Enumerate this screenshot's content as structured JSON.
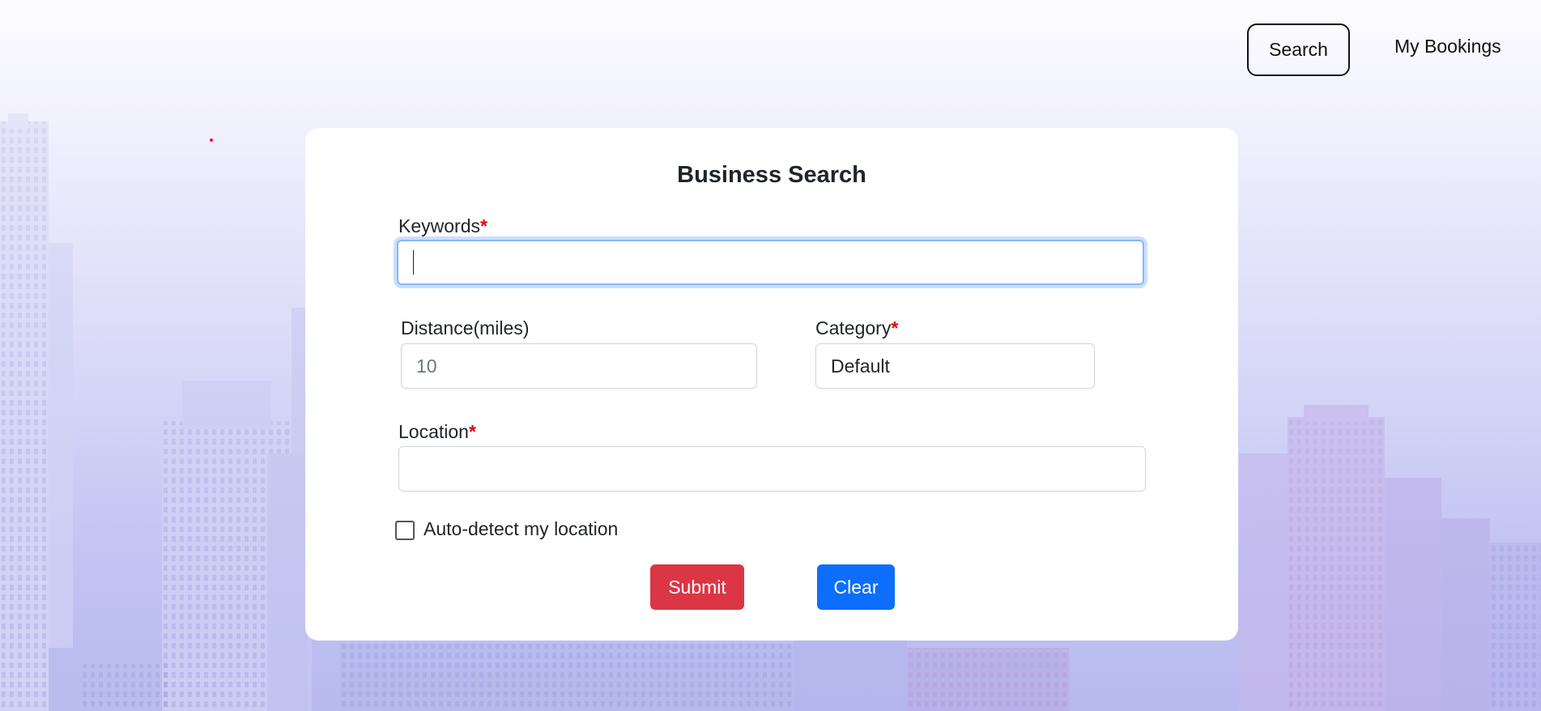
{
  "nav": {
    "search_label": "Search",
    "bookings_label": "My Bookings"
  },
  "form": {
    "title": "Business Search",
    "keywords": {
      "label": "Keywords",
      "required_mark": "*",
      "value": ""
    },
    "distance": {
      "label": "Distance(miles)",
      "placeholder": "10",
      "value": ""
    },
    "category": {
      "label": "Category",
      "required_mark": "*",
      "selected": "Default"
    },
    "location": {
      "label": "Location",
      "required_mark": "*",
      "value": ""
    },
    "auto_detect": {
      "label": "Auto-detect my location",
      "checked": false
    },
    "submit_label": "Submit",
    "clear_label": "Clear"
  },
  "colors": {
    "submit": "#dc3545",
    "clear": "#0d6efd",
    "required": "#e3000f",
    "focus_ring": "#86b7fe"
  }
}
